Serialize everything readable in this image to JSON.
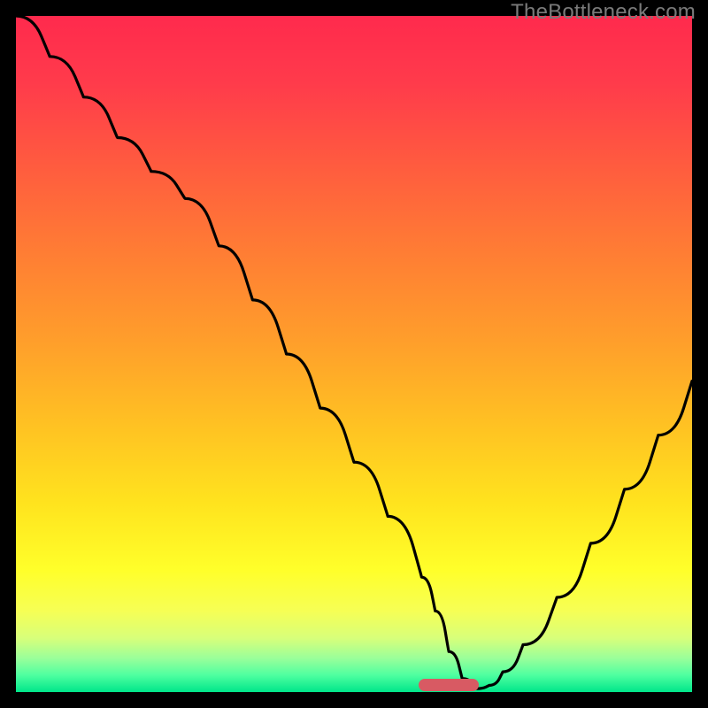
{
  "watermark": "TheBottleneck.com",
  "colors": {
    "gradient_stops": [
      {
        "offset": 0.0,
        "color": "#ff2a4d"
      },
      {
        "offset": 0.1,
        "color": "#ff3b4b"
      },
      {
        "offset": 0.22,
        "color": "#ff5b3f"
      },
      {
        "offset": 0.35,
        "color": "#ff7d34"
      },
      {
        "offset": 0.48,
        "color": "#ff9e2b"
      },
      {
        "offset": 0.6,
        "color": "#ffc023"
      },
      {
        "offset": 0.72,
        "color": "#ffe31e"
      },
      {
        "offset": 0.82,
        "color": "#ffff2a"
      },
      {
        "offset": 0.88,
        "color": "#f6ff55"
      },
      {
        "offset": 0.92,
        "color": "#d8ff7a"
      },
      {
        "offset": 0.95,
        "color": "#9aff9a"
      },
      {
        "offset": 0.975,
        "color": "#4effa0"
      },
      {
        "offset": 1.0,
        "color": "#00e68a"
      }
    ],
    "curve": "#000000",
    "marker": "#d85a63",
    "frame": "#000000"
  },
  "marker": {
    "x_frac": 0.64,
    "width_frac": 0.09,
    "y_frac": 0.99
  },
  "chart_data": {
    "type": "line",
    "title": "",
    "xlabel": "",
    "ylabel": "",
    "xlim": [
      0,
      100
    ],
    "ylim": [
      0,
      100
    ],
    "x": [
      0,
      5,
      10,
      15,
      20,
      25,
      30,
      35,
      40,
      45,
      50,
      55,
      60,
      62,
      64,
      66,
      68,
      70,
      72,
      75,
      80,
      85,
      90,
      95,
      100
    ],
    "values": [
      100,
      94,
      88,
      82,
      77,
      73,
      66,
      58,
      50,
      42,
      34,
      26,
      17,
      12,
      6,
      2,
      0.5,
      1,
      3,
      7,
      14,
      22,
      30,
      38,
      46
    ],
    "annotations": [
      {
        "text": "TheBottleneck.com",
        "role": "watermark"
      }
    ],
    "optimal_x_range": [
      62,
      71
    ]
  }
}
